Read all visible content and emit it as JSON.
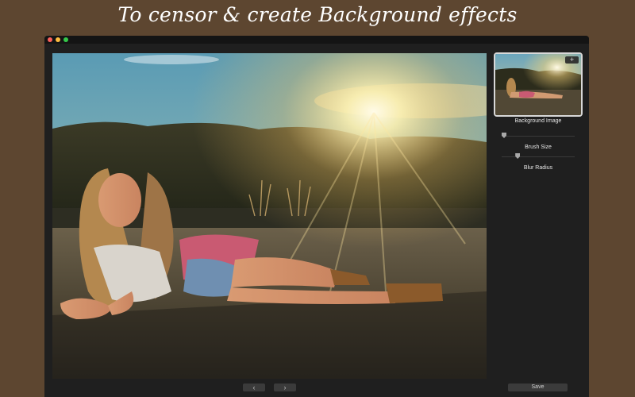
{
  "headline": "To censor & create Background effects",
  "window": {
    "traffic_lights": {
      "close": "#fc605c",
      "minimize": "#fdbc40",
      "maximize": "#34c84a"
    }
  },
  "canvas": {
    "image": "photo-woman-lying-on-road-at-sunset"
  },
  "navigation": {
    "prev_icon": "chevron-left-icon",
    "prev_label": "‹",
    "next_icon": "chevron-right-icon",
    "next_label": "›"
  },
  "sidebar": {
    "background_image_label": "Background Image",
    "add_button_label": "+",
    "brush_size_label": "Brush Size",
    "brush_size_value": 0.0,
    "blur_radius_label": "Blur Radius",
    "blur_radius_value": 0.2
  },
  "save_label": "Save",
  "colors": {
    "page_background": "#5d4630",
    "window_background": "#1f1f1f",
    "button_background": "#3b3b3b",
    "text": "#e6e6e6"
  }
}
